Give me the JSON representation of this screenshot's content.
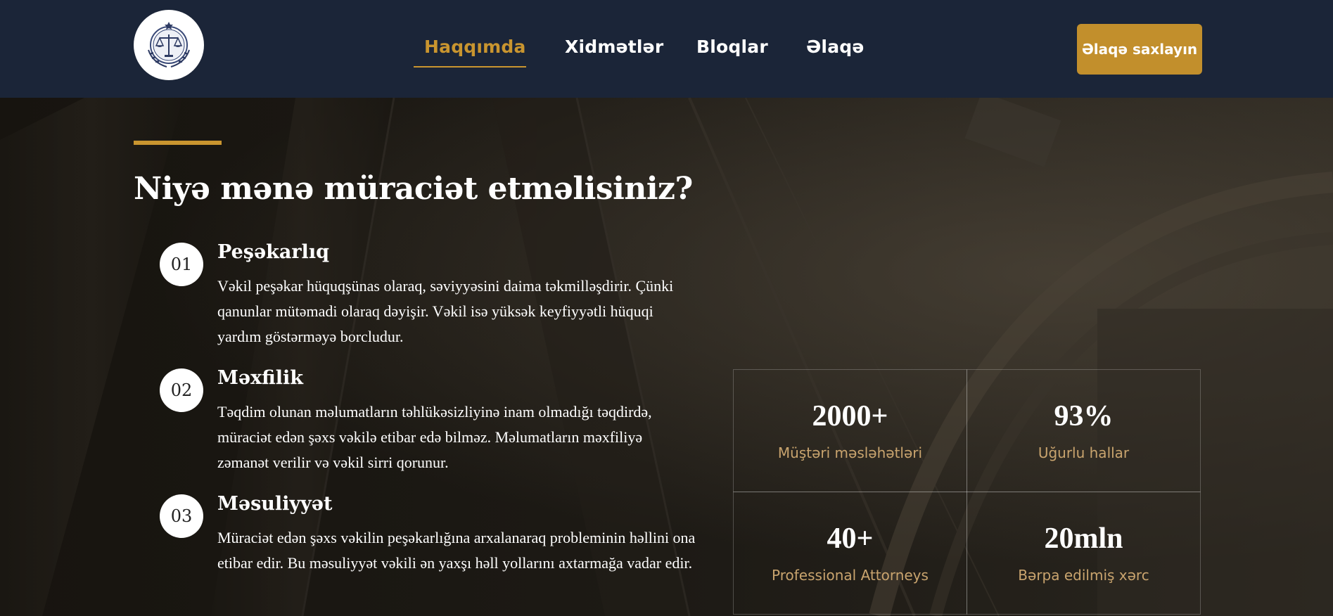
{
  "header": {
    "logo_icon": "scales-of-justice-icon",
    "nav": [
      {
        "label": "Haqqımda",
        "active": true
      },
      {
        "label": "Xidmətlər",
        "active": false
      },
      {
        "label": "Bloqlar",
        "active": false
      },
      {
        "label": "Əlaqə",
        "active": false
      }
    ],
    "cta_label": "Əlaqə saxlayın"
  },
  "hero": {
    "title": "Niyə mənə müraciət etməlisiniz?",
    "reasons": [
      {
        "number": "01",
        "title": "Peşəkarlıq",
        "text": "Vəkil peşəkar hüquqşünas olaraq, səviyyəsini daima təkmilləşdirir. Çünki qanunlar mütəmadi olaraq dəyişir. Vəkil isə yüksək keyfiyyətli hüquqi yardım göstərməyə borcludur."
      },
      {
        "number": "02",
        "title": "Məxfilik",
        "text": "Təqdim olunan məlumatların təhlükəsizliyinə inam olmadığı təqdirdə, müraciət edən şəxs vəkilə etibar edə bilməz. Məlumatların məxfiliyə zəmanət verilir və vəkil sirri qorunur."
      },
      {
        "number": "03",
        "title": "Məsuliyyət",
        "text": "Müraciət edən şəxs vəkilin peşəkarlığına arxalanaraq probleminin həllini ona etibar edir. Bu məsuliyyət vəkili ən yaxşı həll yollarını axtarmağa vadar edir."
      }
    ]
  },
  "stats": [
    {
      "value": "2000+",
      "label": "Müştəri məsləhətləri"
    },
    {
      "value": "93%",
      "label": "Uğurlu hallar"
    },
    {
      "value": "40+",
      "label": "Professional Attorneys"
    },
    {
      "value": "20mln",
      "label": "Bərpa edilmiş xərc"
    }
  ],
  "colors": {
    "header_bg": "#1b2538",
    "accent_gold": "#c9952f",
    "stat_label": "#c9a46e"
  }
}
